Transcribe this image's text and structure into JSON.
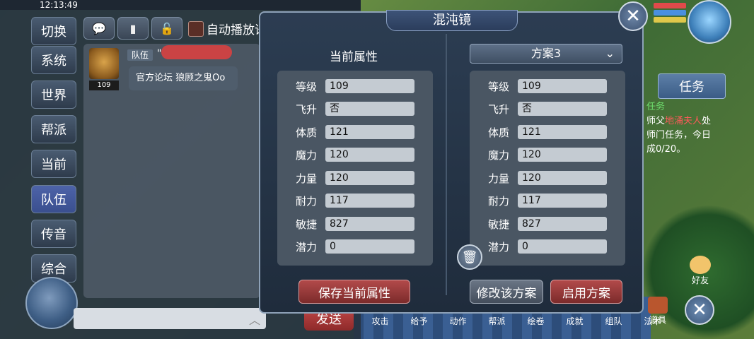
{
  "status_bar": {
    "time": "12:13:49"
  },
  "chat": {
    "side_tabs": [
      "切换",
      "系统",
      "世界",
      "帮派",
      "当前",
      "队伍",
      "传音",
      "综合"
    ],
    "active_tab_index": 5,
    "auto_play_label": "自动播放语",
    "message": {
      "avatar_level": "109",
      "channel_tag": "队伍",
      "quote_mark": "\"",
      "text": "官方论坛 狼顾之鬼Oo"
    },
    "send_label": "发送"
  },
  "hud": {
    "task_button": "任务",
    "quest": {
      "title": "任务",
      "line1_prefix": "师父",
      "line1_name": "地涌夫人",
      "line1_suffix": "处",
      "line2": "师门任务，今日",
      "line3": "成0/20。"
    },
    "friend_label": "好友",
    "bag_label": "道具",
    "toolbar": [
      "攻击",
      "给予",
      "动作",
      "帮派",
      "绘卷",
      "成就",
      "组队",
      "法术"
    ]
  },
  "dialog": {
    "title": "混沌镜",
    "current_title": "当前属性",
    "scheme_selected": "方案3",
    "attributes": [
      {
        "label": "等级",
        "current": "109",
        "scheme": "109"
      },
      {
        "label": "飞升",
        "current": "否",
        "scheme": "否"
      },
      {
        "label": "体质",
        "current": "121",
        "scheme": "121"
      },
      {
        "label": "魔力",
        "current": "120",
        "scheme": "120"
      },
      {
        "label": "力量",
        "current": "120",
        "scheme": "120"
      },
      {
        "label": "耐力",
        "current": "117",
        "scheme": "117"
      },
      {
        "label": "敏捷",
        "current": "827",
        "scheme": "827"
      },
      {
        "label": "潜力",
        "current": "0",
        "scheme": "0"
      }
    ],
    "save_button": "保存当前属性",
    "modify_button": "修改该方案",
    "enable_button": "启用方案"
  },
  "colors": {
    "accent_red": "#b24a4a",
    "panel": "#2c3d52"
  }
}
